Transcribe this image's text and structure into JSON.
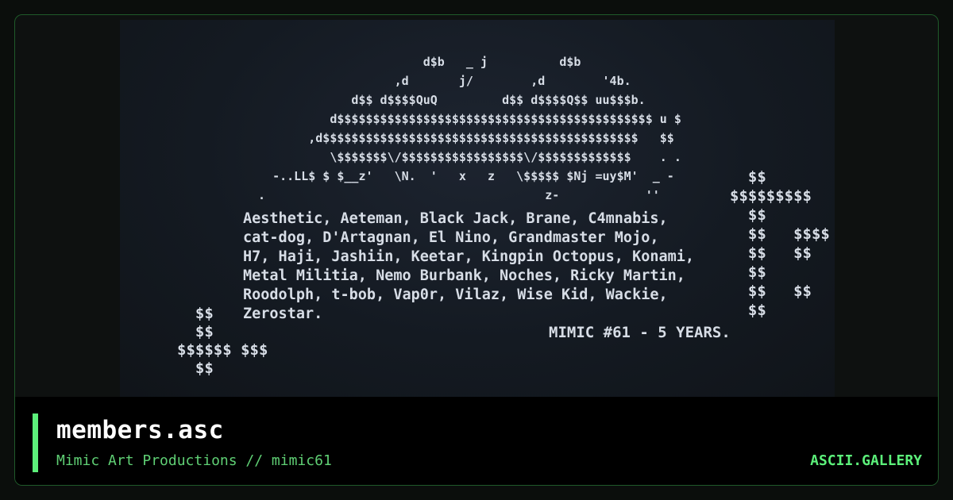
{
  "card": {
    "title": "members.asc",
    "subtitle": "Mimic Art Productions // mimic61",
    "brand": "ASCII.GALLERY",
    "accent_color": "#5cf07a"
  },
  "artwork": {
    "logo_lines": [
      "                        d$b   _ j          d$b",
      "                    ,d       j/        ,d        '4b.",
      "              d$$ d$$$$QuQ         d$$ d$$$$Q$$ uu$$$b.",
      "           d$$$$$$$$$$$$$$$$$$$$$$$$$$$$$$$$$$$$$$$$$$$$ u $",
      "        ,d$$$$$$$$$$$$$$$$$$$$$$$$$$$$$$$$$$$$$$$$$$$$   $$",
      "           \\$$$$$$$\\/$$$$$$$$$$$$$$$$$\\/$$$$$$$$$$$$$    . .",
      "   -..LL$ $ $__z'   \\N.  '   x   z   \\$$$$$ $Nj =uy$M'  _ -",
      " .                                       z-            ''"
    ],
    "credit_lines": [
      "Aesthetic, Aeteman, Black Jack, Brane, C4mnabis,",
      "cat-dog, D'Artagnan, El Nino, Grandmaster Mojo,",
      "H7, Haji, Jashiin, Keetar, Kingpin Octopus, Konami,",
      "Metal Militia, Nemo Burbank, Noches, Ricky Martin,",
      "Roodolph, t-bob, Vap0r, Vilaz, Wise Kid, Wackie,",
      "Zerostar."
    ],
    "signature": "MIMIC #61 - 5 YEARS.",
    "right_dollar_lines": [
      "  $$",
      "$$$$$$$$$",
      "  $$",
      "  $$   $$$$",
      "  $$   $$",
      "  $$",
      "  $$   $$",
      "  $$"
    ],
    "left_dollar_lines": [
      "  $$",
      "  $$",
      "$$$$$$ $$$",
      "  $$"
    ]
  }
}
